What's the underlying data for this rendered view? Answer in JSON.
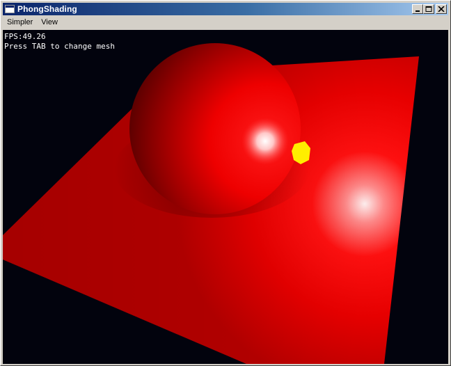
{
  "window": {
    "title": "PhongShading",
    "icon": "app-window-icon",
    "controls": [
      "minimize-icon",
      "maximize-icon",
      "close-icon"
    ]
  },
  "menu": {
    "items": [
      "Simpler",
      "View"
    ]
  },
  "hud": {
    "fps": "FPS:49.26",
    "hint": "Press TAB to change mesh"
  },
  "scene": {
    "background": "#02030d",
    "plane_color": "#ff0000",
    "sphere_color": "#ff0000",
    "light_color": "#ffff00"
  }
}
